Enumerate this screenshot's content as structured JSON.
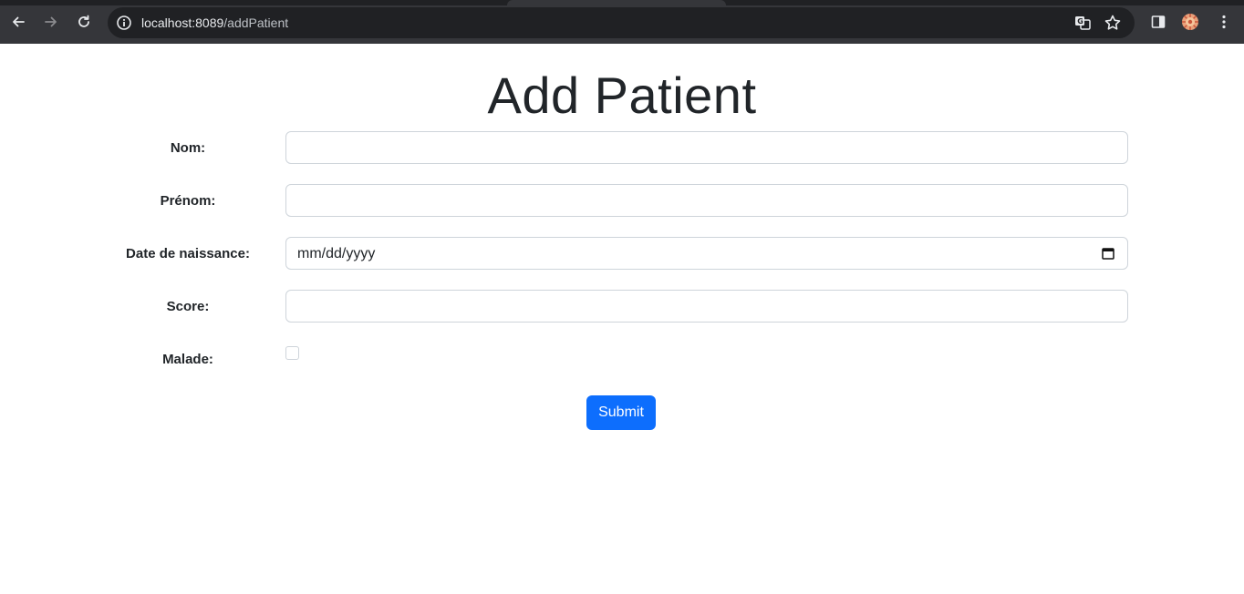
{
  "browser": {
    "url_host": "localhost:8089",
    "url_path": "/addPatient"
  },
  "page": {
    "title": "Add Patient"
  },
  "form": {
    "fields": [
      {
        "label": "Nom:",
        "value": ""
      },
      {
        "label": "Prénom:",
        "value": ""
      },
      {
        "label": "Date de naissance:",
        "placeholder": "mm/dd/yyyy"
      },
      {
        "label": "Score:",
        "value": ""
      },
      {
        "label": "Malade:",
        "checked": false
      }
    ],
    "submit_label": "Submit"
  },
  "colors": {
    "primary": "#0d6efd",
    "chrome_bg": "#35363a",
    "omnibox_bg": "#202124"
  }
}
